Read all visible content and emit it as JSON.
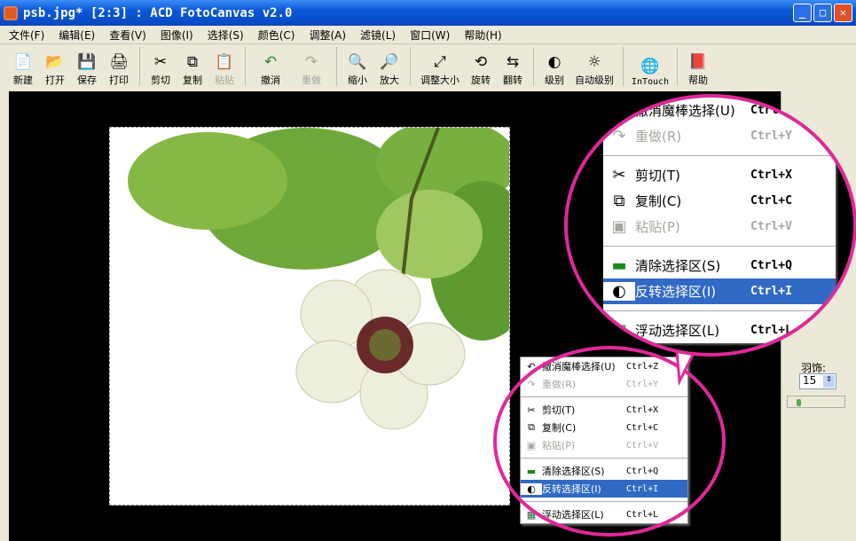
{
  "window": {
    "title": "psb.jpg* [2:3] : ACD FotoCanvas v2.0",
    "minimize": "_",
    "maximize": "□",
    "close": "✕"
  },
  "menubar": [
    "文件(F)",
    "编辑(E)",
    "查看(V)",
    "图像(I)",
    "选择(S)",
    "颜色(C)",
    "调整(A)",
    "滤镜(L)",
    "窗口(W)",
    "帮助(H)"
  ],
  "toolbar": [
    {
      "label": "新建",
      "icon": "📄"
    },
    {
      "label": "打开",
      "icon": "📂"
    },
    {
      "label": "保存",
      "icon": "💾"
    },
    {
      "label": "打印",
      "icon": "🖨"
    },
    {
      "label": "剪切",
      "icon": "✂"
    },
    {
      "label": "复制",
      "icon": "⧉"
    },
    {
      "label": "粘贴",
      "icon": "📋"
    },
    {
      "label": "撤消",
      "icon": "↶"
    },
    {
      "label": "重做",
      "icon": "↷"
    },
    {
      "label": "缩小",
      "icon": "🔍"
    },
    {
      "label": "放大",
      "icon": "🔎"
    },
    {
      "label": "调整大小",
      "icon": "⤢"
    },
    {
      "label": "旋转",
      "icon": "⟲"
    },
    {
      "label": "翻转",
      "icon": "⇆"
    },
    {
      "label": "级别",
      "icon": "◐"
    },
    {
      "label": "自动级别",
      "icon": "☼"
    },
    {
      "label": "InTouch",
      "icon": "🌐"
    },
    {
      "label": "帮助",
      "icon": "📕"
    }
  ],
  "context_menu": [
    {
      "label": "撤消魔棒选择(U)",
      "shortcut": "Ctrl+Z",
      "icon": "↶"
    },
    {
      "label": "重做(R)",
      "shortcut": "Ctrl+Y",
      "icon": "↷",
      "disabled": true
    },
    {
      "label": "剪切(T)",
      "shortcut": "Ctrl+X",
      "icon": "✂"
    },
    {
      "label": "复制(C)",
      "shortcut": "Ctrl+C",
      "icon": "⧉"
    },
    {
      "label": "粘贴(P)",
      "shortcut": "Ctrl+V",
      "icon": "▣",
      "disabled": true
    },
    {
      "label": "清除选择区(S)",
      "shortcut": "Ctrl+Q",
      "icon": "▬"
    },
    {
      "label": "反转选择区(I)",
      "shortcut": "Ctrl+I",
      "icon": "◐",
      "selected": true
    },
    {
      "label": "浮动选择区(L)",
      "shortcut": "Ctrl+L",
      "icon": "▦"
    }
  ],
  "panel": {
    "feather_label": "羽饰:",
    "feather_value": "15"
  },
  "colors": {
    "highlight": "#316ac5",
    "annotation": "#e0289a"
  }
}
